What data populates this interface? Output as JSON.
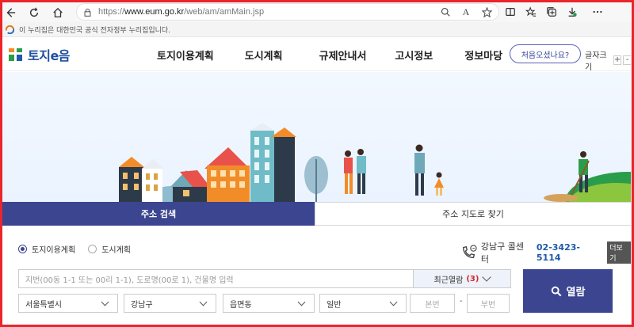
{
  "browser": {
    "url_base": "https://",
    "url_domain": "www.eum.go.kr",
    "url_path": "/web/am/amMain.jsp"
  },
  "gov_notice": "이 누리집은 대한민국 공식 전자정부 누리집입니다.",
  "header": {
    "logo_text": "토지e음",
    "nav": [
      "토지이용계획",
      "도시계획",
      "규제안내서",
      "고시정보",
      "정보마당"
    ],
    "first_visit_label": "처음오셨나요?",
    "font_size_label": "글자크기",
    "font_plus": "+",
    "font_minus": "-"
  },
  "tabs": {
    "address_search": "주소 검색",
    "map_search": "주소 지도로 찾기"
  },
  "search": {
    "radio_land": "토지이용계획",
    "radio_city": "도시계획",
    "selected_radio": "토지이용계획",
    "call_label": "강남구 콜센터",
    "call_number": "02-3423-5114",
    "call_more": "더보기",
    "address_placeholder": "지번(00동 1-1 또는 00리 1-1), 도로명(00로 1), 건물명 입력",
    "recent_label": "최근열람",
    "recent_count": "(3)",
    "select_sido": "서울특별시",
    "select_sigungu": "강남구",
    "select_dong": "읍면동",
    "select_type": "일반",
    "bonbun_placeholder": "본번",
    "bubun_placeholder": "부번",
    "dash": "-",
    "view_button": "열람"
  },
  "colors": {
    "accent": "#3c4590",
    "frame": "#e8262b",
    "phone": "#1e5aa8"
  }
}
